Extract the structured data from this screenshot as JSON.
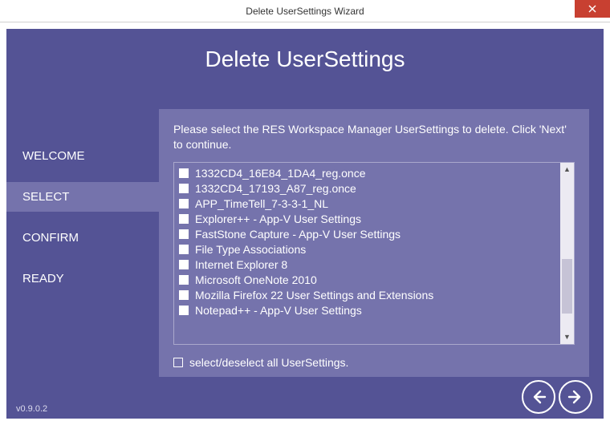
{
  "window": {
    "title": "Delete UserSettings Wizard"
  },
  "wizard": {
    "heading": "Delete UserSettings",
    "version": "v0.9.0.2"
  },
  "steps": {
    "items": [
      {
        "label": "WELCOME",
        "active": false
      },
      {
        "label": "SELECT",
        "active": true
      },
      {
        "label": "CONFIRM",
        "active": false
      },
      {
        "label": "READY",
        "active": false
      }
    ]
  },
  "panel": {
    "instructions": "Please select the RES Workspace Manager UserSettings to delete. Click 'Next' to continue.",
    "items": [
      {
        "label": "1332CD4_16E84_1DA4_reg.once"
      },
      {
        "label": "1332CD4_17193_A87_reg.once"
      },
      {
        "label": "APP_TimeTell_7-3-3-1_NL"
      },
      {
        "label": "Explorer++ - App-V User Settings"
      },
      {
        "label": "FastStone Capture - App-V User Settings"
      },
      {
        "label": "File Type Associations"
      },
      {
        "label": "Internet Explorer 8"
      },
      {
        "label": "Microsoft OneNote 2010"
      },
      {
        "label": "Mozilla Firefox 22 User Settings and Extensions"
      },
      {
        "label": "Notepad++ - App-V User Settings"
      }
    ],
    "selectAll": "select/deselect all UserSettings."
  }
}
